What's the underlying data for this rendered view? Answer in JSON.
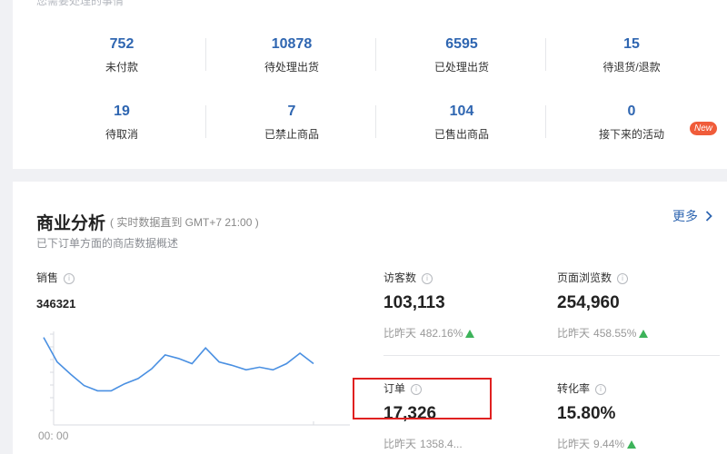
{
  "todo": {
    "hint": "您需要处理的事情",
    "items": [
      {
        "value": "752",
        "label": "未付款"
      },
      {
        "value": "10878",
        "label": "待处理出货"
      },
      {
        "value": "6595",
        "label": "已处理出货"
      },
      {
        "value": "15",
        "label": "待退货/退款"
      },
      {
        "value": "19",
        "label": "待取消"
      },
      {
        "value": "7",
        "label": "已禁止商品"
      },
      {
        "value": "104",
        "label": "已售出商品"
      },
      {
        "value": "0",
        "label": "接下来的活动"
      }
    ],
    "new_badge": "New"
  },
  "business": {
    "title": "商业分析",
    "subtitle": "( 实时数据直到 GMT+7 21:00 )",
    "description": "已下订单方面的商店数据概述",
    "more": "更多",
    "sales": {
      "label": "销售",
      "value": "346321",
      "x_start": "00: 00"
    },
    "metrics": [
      {
        "label": "访客数",
        "value": "103,113",
        "compare": "比昨天",
        "pct": "482.16%"
      },
      {
        "label": "页面浏览数",
        "value": "254,960",
        "compare": "比昨天",
        "pct": "458.55%"
      },
      {
        "label": "订单",
        "value": "17,326",
        "compare": "比昨天",
        "pct": "1358.4..."
      },
      {
        "label": "转化率",
        "value": "15.80%",
        "compare": "比昨天",
        "pct": "9.44%"
      }
    ]
  },
  "colors": {
    "accent": "#2f66b1",
    "line": "#4a90e2",
    "up": "#3db35a",
    "badge": "#f05c3a",
    "highlight": "#e02020"
  },
  "chart_data": {
    "type": "line",
    "x": [
      "00:00",
      "",
      "",
      "",
      "",
      "",
      "",
      "",
      "",
      "",
      "",
      "",
      "",
      "",
      "",
      "",
      "",
      "",
      "",
      "",
      ""
    ],
    "series": [
      {
        "values": [
          100,
          72,
          58,
          45,
          39,
          39,
          47,
          53,
          64,
          80,
          76,
          70,
          88,
          72,
          68,
          63,
          66,
          63,
          70,
          82,
          70
        ]
      }
    ],
    "ylim": [
      0,
      110
    ],
    "grid": false
  }
}
